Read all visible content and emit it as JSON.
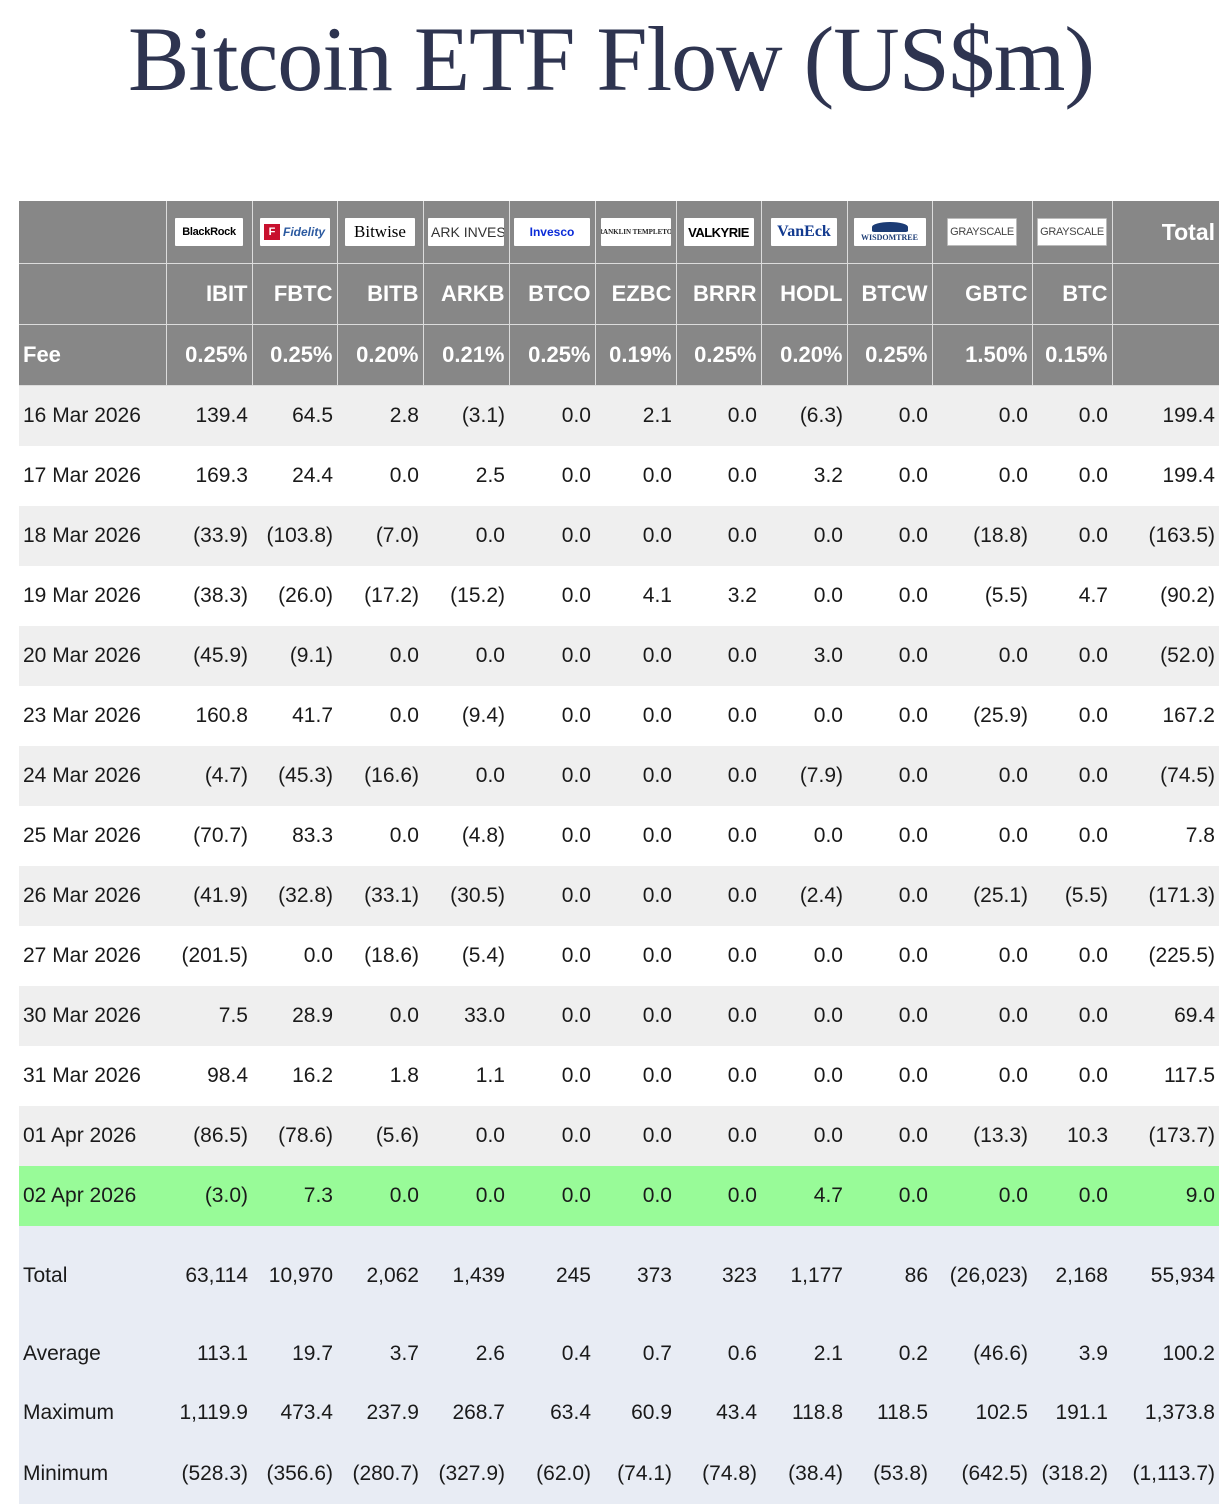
{
  "title": "Bitcoin ETF Flow (US$m)",
  "header": {
    "logos": [
      {
        "name": "blackrock-logo",
        "text": "BlackRock"
      },
      {
        "name": "fidelity-logo",
        "text": "Fidelity"
      },
      {
        "name": "bitwise-logo",
        "text": "Bitwise"
      },
      {
        "name": "ark-invest-logo",
        "text": "ARK INVEST"
      },
      {
        "name": "invesco-logo",
        "text": "Invesco"
      },
      {
        "name": "franklin-templeton-logo",
        "text": "FRANKLIN TEMPLETON"
      },
      {
        "name": "valkyrie-logo",
        "text": "VALKYRIE"
      },
      {
        "name": "vaneck-logo",
        "text": "VanEck"
      },
      {
        "name": "wisdomtree-logo",
        "text": "WISDOMTREE"
      },
      {
        "name": "grayscale-logo",
        "text": "GRAYSCALE"
      },
      {
        "name": "grayscale-logo",
        "text": "GRAYSCALE"
      }
    ],
    "total_label": "Total",
    "tickers": [
      "IBIT",
      "FBTC",
      "BITB",
      "ARKB",
      "BTCO",
      "EZBC",
      "BRRR",
      "HODL",
      "BTCW",
      "GBTC",
      "BTC"
    ],
    "fee_label": "Fee",
    "fees": [
      "0.25%",
      "0.25%",
      "0.20%",
      "0.21%",
      "0.25%",
      "0.19%",
      "0.25%",
      "0.20%",
      "0.25%",
      "1.50%",
      "0.15%"
    ]
  },
  "rows": [
    {
      "date": "16 Mar 2026",
      "values": [
        "139.4",
        "64.5",
        "2.8",
        "(3.1)",
        "0.0",
        "2.1",
        "0.0",
        "(6.3)",
        "0.0",
        "0.0",
        "0.0",
        "199.4"
      ]
    },
    {
      "date": "17 Mar 2026",
      "values": [
        "169.3",
        "24.4",
        "0.0",
        "2.5",
        "0.0",
        "0.0",
        "0.0",
        "3.2",
        "0.0",
        "0.0",
        "0.0",
        "199.4"
      ]
    },
    {
      "date": "18 Mar 2026",
      "values": [
        "(33.9)",
        "(103.8)",
        "(7.0)",
        "0.0",
        "0.0",
        "0.0",
        "0.0",
        "0.0",
        "0.0",
        "(18.8)",
        "0.0",
        "(163.5)"
      ]
    },
    {
      "date": "19 Mar 2026",
      "values": [
        "(38.3)",
        "(26.0)",
        "(17.2)",
        "(15.2)",
        "0.0",
        "4.1",
        "3.2",
        "0.0",
        "0.0",
        "(5.5)",
        "4.7",
        "(90.2)"
      ]
    },
    {
      "date": "20 Mar 2026",
      "values": [
        "(45.9)",
        "(9.1)",
        "0.0",
        "0.0",
        "0.0",
        "0.0",
        "0.0",
        "3.0",
        "0.0",
        "0.0",
        "0.0",
        "(52.0)"
      ]
    },
    {
      "date": "23 Mar 2026",
      "values": [
        "160.8",
        "41.7",
        "0.0",
        "(9.4)",
        "0.0",
        "0.0",
        "0.0",
        "0.0",
        "0.0",
        "(25.9)",
        "0.0",
        "167.2"
      ]
    },
    {
      "date": "24 Mar 2026",
      "values": [
        "(4.7)",
        "(45.3)",
        "(16.6)",
        "0.0",
        "0.0",
        "0.0",
        "0.0",
        "(7.9)",
        "0.0",
        "0.0",
        "0.0",
        "(74.5)"
      ]
    },
    {
      "date": "25 Mar 2026",
      "values": [
        "(70.7)",
        "83.3",
        "0.0",
        "(4.8)",
        "0.0",
        "0.0",
        "0.0",
        "0.0",
        "0.0",
        "0.0",
        "0.0",
        "7.8"
      ]
    },
    {
      "date": "26 Mar 2026",
      "values": [
        "(41.9)",
        "(32.8)",
        "(33.1)",
        "(30.5)",
        "0.0",
        "0.0",
        "0.0",
        "(2.4)",
        "0.0",
        "(25.1)",
        "(5.5)",
        "(171.3)"
      ]
    },
    {
      "date": "27 Mar 2026",
      "values": [
        "(201.5)",
        "0.0",
        "(18.6)",
        "(5.4)",
        "0.0",
        "0.0",
        "0.0",
        "0.0",
        "0.0",
        "0.0",
        "0.0",
        "(225.5)"
      ]
    },
    {
      "date": "30 Mar 2026",
      "values": [
        "7.5",
        "28.9",
        "0.0",
        "33.0",
        "0.0",
        "0.0",
        "0.0",
        "0.0",
        "0.0",
        "0.0",
        "0.0",
        "69.4"
      ]
    },
    {
      "date": "31 Mar 2026",
      "values": [
        "98.4",
        "16.2",
        "1.8",
        "1.1",
        "0.0",
        "0.0",
        "0.0",
        "0.0",
        "0.0",
        "0.0",
        "0.0",
        "117.5"
      ]
    },
    {
      "date": "01 Apr 2026",
      "values": [
        "(86.5)",
        "(78.6)",
        "(5.6)",
        "0.0",
        "0.0",
        "0.0",
        "0.0",
        "0.0",
        "0.0",
        "(13.3)",
        "10.3",
        "(173.7)"
      ]
    },
    {
      "date": "02 Apr 2026",
      "values": [
        "(3.0)",
        "7.3",
        "0.0",
        "0.0",
        "0.0",
        "0.0",
        "0.0",
        "4.7",
        "0.0",
        "0.0",
        "0.0",
        "9.0"
      ]
    }
  ],
  "summary": [
    {
      "label": "Total",
      "values": [
        "63,114",
        "10,970",
        "2,062",
        "1,439",
        "245",
        "373",
        "323",
        "1,177",
        "86",
        "(26,023)",
        "2,168",
        "55,934"
      ]
    },
    {
      "label": "Average",
      "values": [
        "113.1",
        "19.7",
        "3.7",
        "2.6",
        "0.4",
        "0.7",
        "0.6",
        "2.1",
        "0.2",
        "(46.6)",
        "3.9",
        "100.2"
      ]
    },
    {
      "label": "Maximum",
      "values": [
        "1,119.9",
        "473.4",
        "237.9",
        "268.7",
        "63.4",
        "60.9",
        "43.4",
        "118.8",
        "118.5",
        "102.5",
        "191.1",
        "1,373.8"
      ]
    },
    {
      "label": "Minimum",
      "values": [
        "(528.3)",
        "(356.6)",
        "(280.7)",
        "(327.9)",
        "(62.0)",
        "(74.1)",
        "(74.8)",
        "(38.4)",
        "(53.8)",
        "(642.5)",
        "(318.2)",
        "(1,113.7)"
      ]
    }
  ],
  "colors": {
    "header_bg": "#878787",
    "row_alt": "#efefef",
    "row_latest": "#98fb98",
    "summary_bg": "#e8ecf4",
    "negative": "#e8000b",
    "title": "#2e3450"
  }
}
